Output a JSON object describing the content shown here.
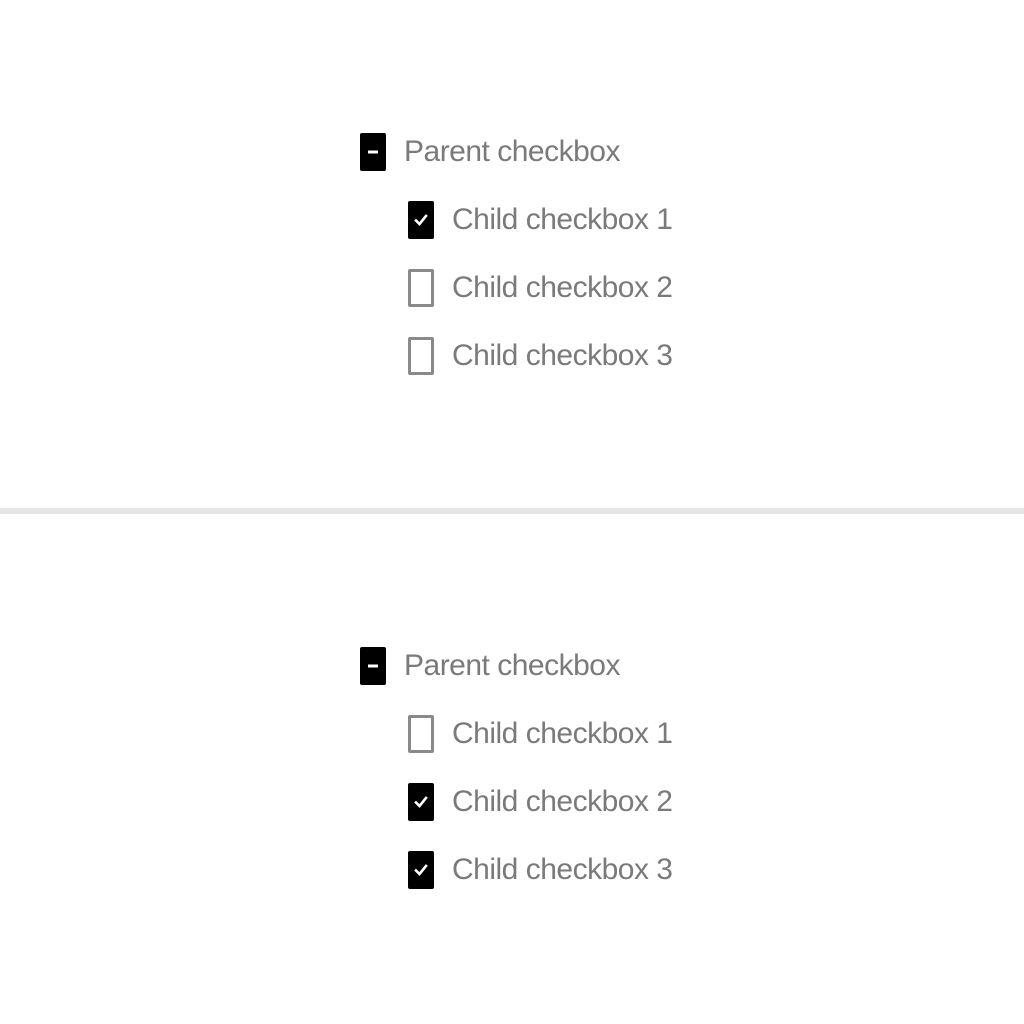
{
  "examples": [
    {
      "parent": {
        "label": "Parent checkbox",
        "state": "mixed"
      },
      "children": [
        {
          "label": "Child checkbox 1",
          "state": "checked"
        },
        {
          "label": "Child checkbox 2",
          "state": "unchecked"
        },
        {
          "label": "Child checkbox 3",
          "state": "unchecked"
        }
      ]
    },
    {
      "parent": {
        "label": "Parent checkbox",
        "state": "mixed"
      },
      "children": [
        {
          "label": "Child checkbox 1",
          "state": "unchecked"
        },
        {
          "label": "Child checkbox 2",
          "state": "checked"
        },
        {
          "label": "Child checkbox 3",
          "state": "checked"
        }
      ]
    }
  ],
  "icons": {
    "checked": "check-icon",
    "mixed": "minus-icon"
  },
  "colors": {
    "checked_fill": "#000000",
    "unchecked_border": "#8a8a8a",
    "label_text": "#7a7a7a",
    "divider": "#e6e6e6"
  }
}
